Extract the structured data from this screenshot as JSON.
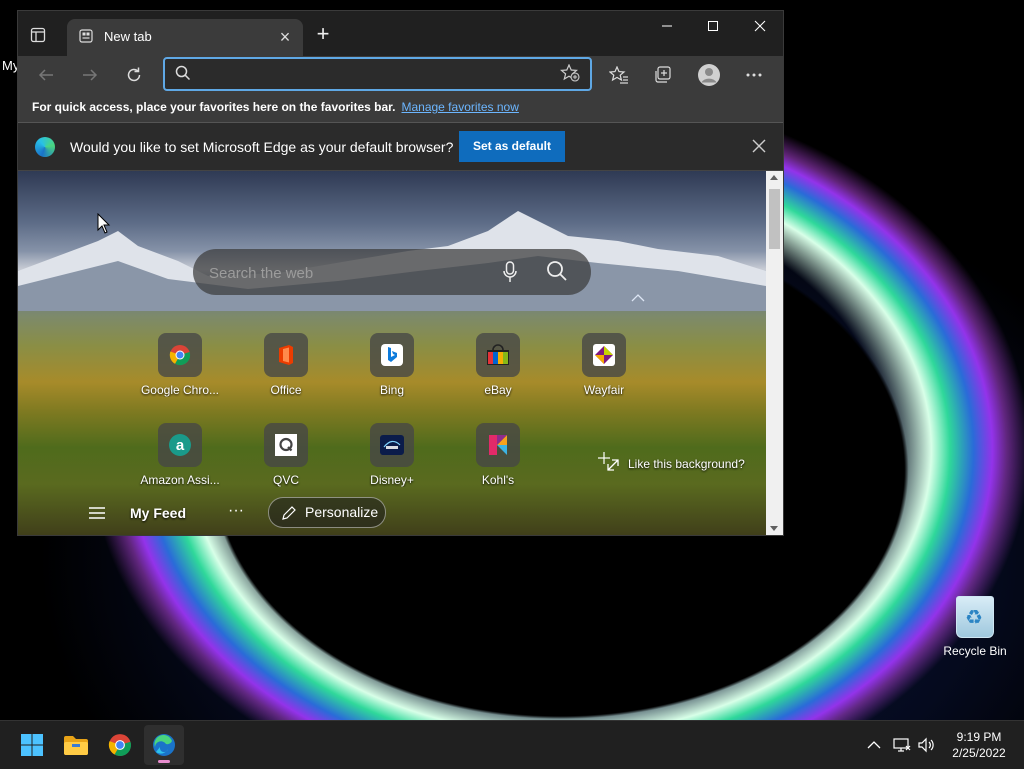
{
  "desktop": {
    "partial_label": "My",
    "recycle_bin_label": "Recycle Bin"
  },
  "browser": {
    "tab": {
      "title": "New tab"
    },
    "address_bar": {
      "value": "",
      "placeholder": ""
    },
    "favorites_bar": {
      "message": "For quick access, place your favorites here on the favorites bar.",
      "link": "Manage favorites now"
    },
    "infobar": {
      "message": "Would you like to set Microsoft Edge as your default browser?",
      "button": "Set as default"
    },
    "newtab": {
      "search_placeholder": "Search the web",
      "tiles": [
        {
          "label": "Google Chro...",
          "icon": "chrome-icon"
        },
        {
          "label": "Office",
          "icon": "office-icon"
        },
        {
          "label": "Bing",
          "icon": "bing-icon"
        },
        {
          "label": "eBay",
          "icon": "ebay-icon"
        },
        {
          "label": "Wayfair",
          "icon": "wayfair-icon"
        },
        {
          "label": "Amazon Assi...",
          "icon": "amazon-icon"
        },
        {
          "label": "QVC",
          "icon": "qvc-icon"
        },
        {
          "label": "Disney+",
          "icon": "disney-icon"
        },
        {
          "label": "Kohl's",
          "icon": "kohls-icon"
        }
      ],
      "like_background": "Like this background?",
      "feed": {
        "my_feed": "My Feed",
        "more": "···",
        "personalize": "Personalize"
      }
    }
  },
  "taskbar": {
    "time": "9:19 PM",
    "date": "2/25/2022"
  },
  "colors": {
    "accent": "#0f6cbd",
    "link": "#6cb6ff",
    "address_border": "#5fa8e5"
  }
}
